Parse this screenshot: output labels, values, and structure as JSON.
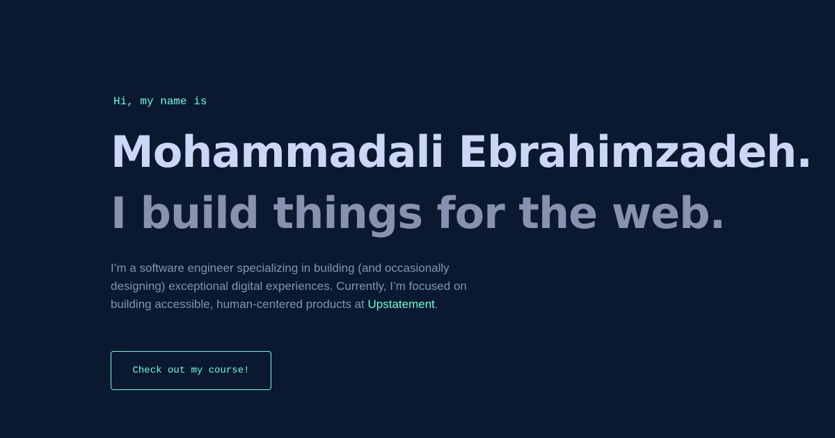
{
  "hero": {
    "greeting": "Hi, my name is",
    "name": "Mohammadali Ebrahimzadeh.",
    "tagline": "I build things for the web.",
    "intro_before_link": "I’m a software engineer specializing in building (and occasionally designing) exceptional digital experiences. Currently, I’m focused on building accessible, human-centered products at ",
    "intro_link": "Upstatement",
    "intro_after_link": ".",
    "cta_label": "Check out my course!"
  },
  "colors": {
    "background": "#0a192f",
    "accent": "#64ffda",
    "heading": "#ccd6f6",
    "text": "#8892b0"
  }
}
